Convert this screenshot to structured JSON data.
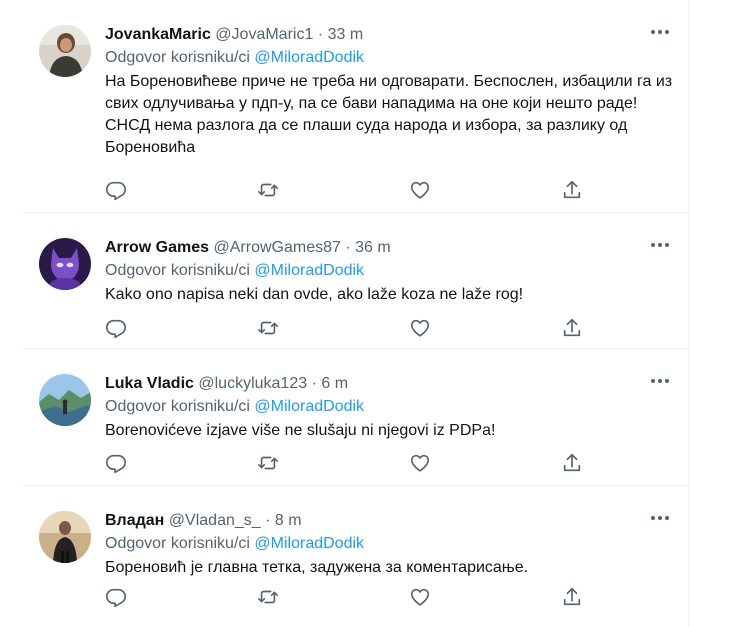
{
  "colors": {
    "link": "#1d9bf0",
    "secondary_text": "#536471",
    "primary_text": "#0f1419",
    "divider": "#eff3f4"
  },
  "tweets": [
    {
      "name": "JovankaMaric",
      "handle": "@JovaMaric1",
      "time": "33 m",
      "reply_prefix": "Odgovor korisniku/ci",
      "reply_to": "@MiloradDodik",
      "text": "На Бореновићеве приче не треба ни одговарати. Беспослен, избацили га из свих одлучивања у пдп-у, па се бави нападима на оне који нешто раде! СНСД нема разлога да се плаши суда народа и избора, за разлику од Бореновића",
      "avatar_icon": "profile-photo-person"
    },
    {
      "name": "Arrow Games",
      "handle": "@ArrowGames87",
      "time": "36 m",
      "reply_prefix": "Odgovor korisniku/ci",
      "reply_to": "@MiloradDodik",
      "text": "Kako ono napisa neki dan ovde, ako laže koza ne laže rog!",
      "avatar_icon": "profile-photo-purple-character"
    },
    {
      "name": "Luka Vladic",
      "handle": "@luckyluka123",
      "time": "6 m",
      "reply_prefix": "Odgovor korisniku/ci",
      "reply_to": "@MiloradDodik",
      "text": "Borenovićeve izjave više ne slušaju ni njegovi iz PDPa!",
      "avatar_icon": "profile-photo-landscape"
    },
    {
      "name": "Владан",
      "handle": "@Vladan_s_",
      "time": "8 m",
      "reply_prefix": "Odgovor korisniku/ci",
      "reply_to": "@MiloradDodik",
      "text": "Бореновић је главна тетка, задужена за коментарисање.",
      "avatar_icon": "profile-photo-person-dark"
    }
  ],
  "separator": "·",
  "action_icons": [
    "reply-icon",
    "retweet-icon",
    "like-icon",
    "share-icon"
  ],
  "more_icon": "more-options-icon"
}
